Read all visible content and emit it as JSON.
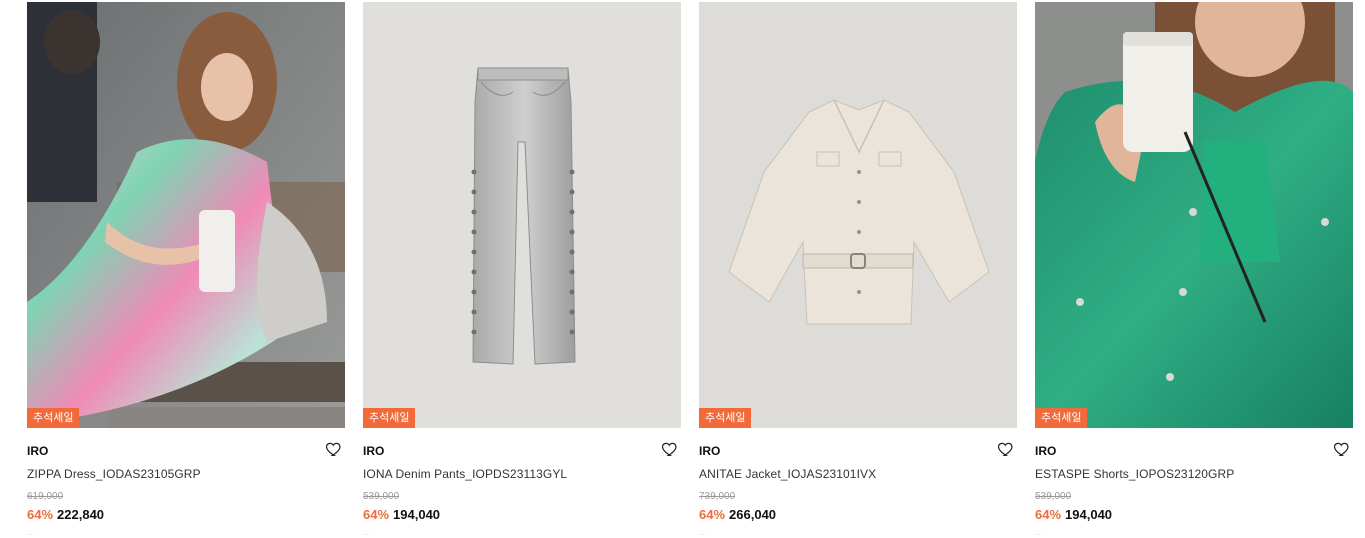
{
  "products": [
    {
      "badge": "추석세일",
      "brand": "IRO",
      "name": "ZIPPA Dress_IODAS23105GRP",
      "original_price": "619,000",
      "discount": "64%",
      "sale_price": "222,840",
      "extra": "··"
    },
    {
      "badge": "추석세일",
      "brand": "IRO",
      "name": "IONA Denim Pants_IOPDS23113GYL",
      "original_price": "539,000",
      "discount": "64%",
      "sale_price": "194,040",
      "extra": "··"
    },
    {
      "badge": "추석세일",
      "brand": "IRO",
      "name": "ANITAE Jacket_IOJAS23101IVX",
      "original_price": "739,000",
      "discount": "64%",
      "sale_price": "266,040",
      "extra": "··"
    },
    {
      "badge": "추석세일",
      "brand": "IRO",
      "name": "ESTASPE Shorts_IOPOS23120GRP",
      "original_price": "539,000",
      "discount": "64%",
      "sale_price": "194,040",
      "extra": "··"
    }
  ],
  "icons": {
    "wishlist": "heart-outline-icon"
  },
  "colors": {
    "badge": "#f06a3c",
    "discount": "#f06a3c",
    "original_price": "#9a9a9a"
  }
}
